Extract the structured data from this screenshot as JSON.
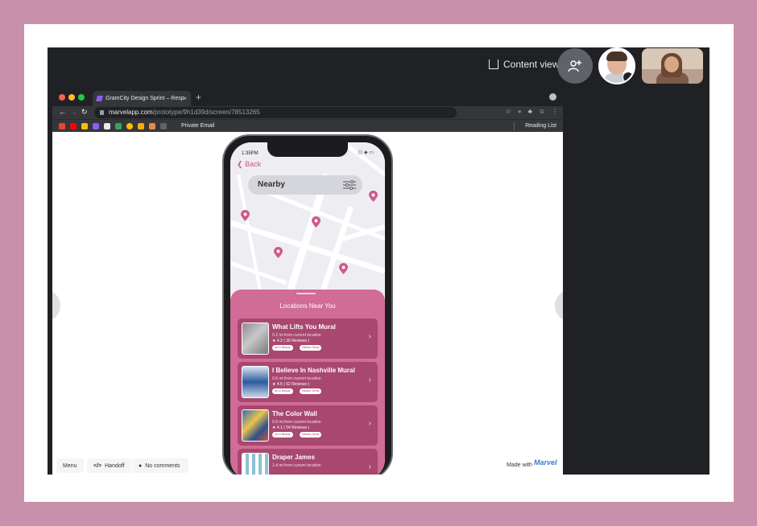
{
  "meeting": {
    "content_view_label": "Content view",
    "add_people_icon": "add-person-icon",
    "participant_pin_icon": "pin-icon"
  },
  "browser": {
    "tab_title": "GramCity Design Sprint – Resp",
    "url_host": "marvelapp.com",
    "url_path": "/prototype/9h1d39d/screen/78513265",
    "bookmark_label": "Private Email",
    "reading_list_label": "Reading List"
  },
  "marvel_footer": {
    "menu_label": "Menu",
    "handoff_label": "Handoff",
    "comments_label": "No comments",
    "made_with_label": "Made with",
    "brand": "Marvel"
  },
  "app": {
    "status_time": "1:35PM",
    "back_label": "Back",
    "search_value": "Nearby",
    "sheet_title": "Locations Near You",
    "accent_color": "#d06c96",
    "locations": [
      {
        "title": "What Lifts You Mural",
        "distance": "0.2 mi from current location",
        "rating": "★ 4.2 ( 30 Reviews )",
        "tags": [
          "Art & Beauty",
          "Hidden Gems"
        ]
      },
      {
        "title": "I Believe In Nashville Mural",
        "distance": "0.6 mi from current location",
        "rating": "★ 4.5 ( 62 Reviews )",
        "tags": [
          "Art & Beauty",
          "Hidden Gems"
        ]
      },
      {
        "title": "The Color Wall",
        "distance": "0.9 mi from current location",
        "rating": "★ 4.1 ( 54 Reviews )",
        "tags": [
          "Art & Beauty",
          "Hidden Gems"
        ]
      },
      {
        "title": "Draper James",
        "distance": "1.4 mi from current location",
        "rating": "",
        "tags": []
      }
    ]
  }
}
